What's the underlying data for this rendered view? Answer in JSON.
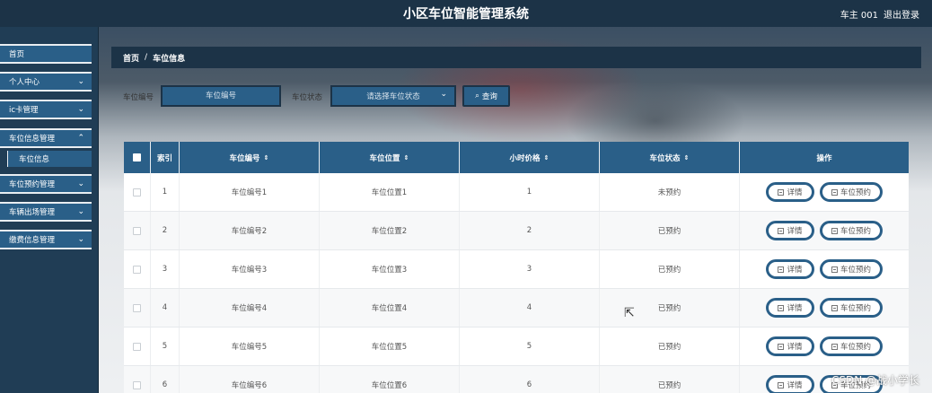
{
  "header": {
    "title": "小区车位智能管理系统",
    "user": "车主 001",
    "logout": "退出登录"
  },
  "sidebar": {
    "items": [
      {
        "label": "首页"
      },
      {
        "label": "个人中心"
      },
      {
        "label": "ic卡管理"
      },
      {
        "label": "车位信息管理"
      },
      {
        "label": "车位预约管理"
      },
      {
        "label": "车辆出场管理"
      },
      {
        "label": "缴费信息管理"
      }
    ],
    "sub_items": [
      {
        "label": "车位信息"
      }
    ]
  },
  "breadcrumb": {
    "home": "首页",
    "sep": "/",
    "current": "车位信息"
  },
  "search": {
    "code_label": "车位编号",
    "code_placeholder": "车位编号",
    "status_label": "车位状态",
    "status_placeholder": "请选择车位状态",
    "button": "查询"
  },
  "table": {
    "headers": [
      "索引",
      "车位编号",
      "车位位置",
      "小时价格",
      "车位状态",
      "操作"
    ],
    "sort_icon": "⇕",
    "detail_label": "详情",
    "book_label": "车位预约",
    "rows": [
      {
        "index": "1",
        "code": "车位编号1",
        "location": "车位位置1",
        "price": "1",
        "status": "未预约"
      },
      {
        "index": "2",
        "code": "车位编号2",
        "location": "车位位置2",
        "price": "2",
        "status": "已预约"
      },
      {
        "index": "3",
        "code": "车位编号3",
        "location": "车位位置3",
        "price": "3",
        "status": "已预约"
      },
      {
        "index": "4",
        "code": "车位编号4",
        "location": "车位位置4",
        "price": "4",
        "status": "已预约"
      },
      {
        "index": "5",
        "code": "车位编号5",
        "location": "车位位置5",
        "price": "5",
        "status": "已预约"
      },
      {
        "index": "6",
        "code": "车位编号6",
        "location": "车位位置6",
        "price": "6",
        "status": "已预约"
      }
    ]
  },
  "watermark": "CSDN @战小学长",
  "colors": {
    "primary": "#2a5f88",
    "header": "#1c3347"
  }
}
